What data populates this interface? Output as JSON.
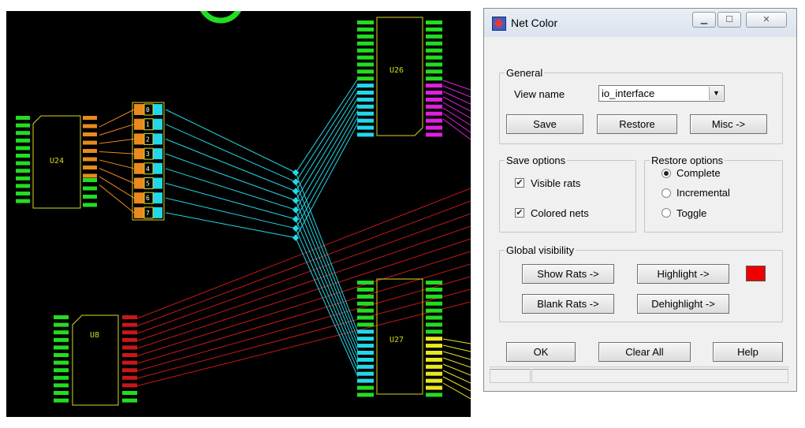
{
  "canvas": {
    "background": "#000000",
    "parts": [
      {
        "ref": "U24"
      },
      {
        "ref": "U26"
      },
      {
        "ref": "U27"
      },
      {
        "ref": "U8"
      }
    ],
    "connector_pins": [
      "0",
      "1",
      "2",
      "3",
      "4",
      "5",
      "6",
      "7"
    ],
    "colors": {
      "pad": "#22dd22",
      "outline": "#d8d820",
      "rat_cyan": "#22d8e8",
      "rat_red": "#c81818",
      "rat_magenta": "#e020e0",
      "rat_yellow": "#e8e820",
      "rat_orange": "#e88a20"
    }
  },
  "dialog": {
    "title": "Net Color",
    "window_buttons": {
      "minimize": "▁",
      "maximize": "☐",
      "close": "✕"
    },
    "general": {
      "legend": "General",
      "view_name_label": "View name",
      "view_name_value": "io_interface",
      "save": "Save",
      "restore": "Restore",
      "misc": "Misc ->"
    },
    "save_options": {
      "legend": "Save options",
      "visible_rats": {
        "label": "Visible rats",
        "checked": true
      },
      "colored_nets": {
        "label": "Colored nets",
        "checked": true
      }
    },
    "restore_options": {
      "legend": "Restore options",
      "options": [
        "Complete",
        "Incremental",
        "Toggle"
      ],
      "selected": "Complete"
    },
    "global_visibility": {
      "legend": "Global visibility",
      "show_rats": "Show Rats ->",
      "highlight": "Highlight ->",
      "blank_rats": "Blank Rats ->",
      "dehighlight": "Dehighlight ->",
      "highlight_color": "#ee0000"
    },
    "footer": {
      "ok": "OK",
      "clear_all": "Clear All",
      "help": "Help"
    }
  }
}
